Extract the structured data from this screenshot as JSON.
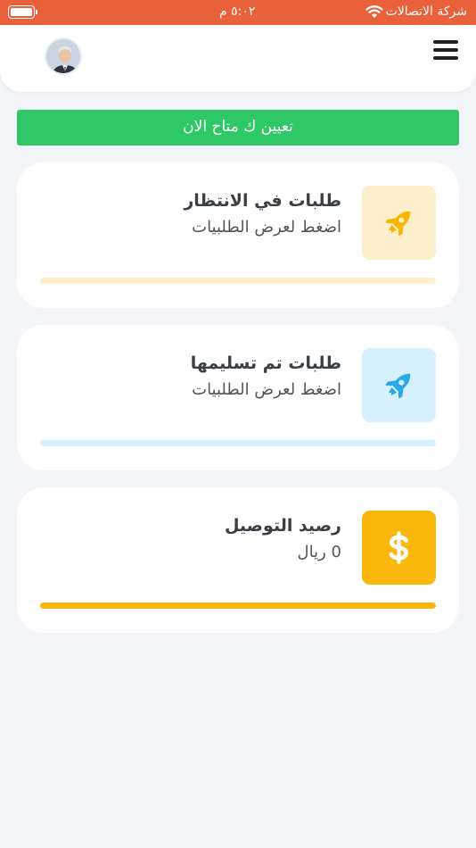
{
  "status_bar": {
    "carrier": "شركة الاتصالات",
    "time": "٥:٠٢ م",
    "icons": [
      "wifi-icon",
      "battery-icon"
    ]
  },
  "header": {
    "menu_icon": "hamburger-menu-icon",
    "avatar": "user-avatar"
  },
  "availability_button": {
    "label": "تعيين ك متاح الان"
  },
  "cards": [
    {
      "title": "طلبات في الانتظار",
      "subtitle": "اضغط لعرض الطلبيات",
      "icon": "rocket-icon",
      "icon_color": "#f7b600",
      "icon_bg": "#fdefcb",
      "bar_color": "#fdefcb"
    },
    {
      "title": "طلبات تم تسليمها",
      "subtitle": "اضغط لعرض الطلبيات",
      "icon": "rocket-icon",
      "icon_color": "#2aa8e8",
      "icon_bg": "#d6f1fd",
      "bar_color": "#d6f1fd"
    },
    {
      "title": "رصيد التوصيل",
      "subtitle": "0 ريال",
      "icon": "dollar-icon",
      "icon_color": "#ffffff",
      "icon_bg": "#fbb80c",
      "bar_color": "#fbb80c"
    }
  ],
  "colors": {
    "status_bar": "#e9613a",
    "available_green": "#2ec866",
    "background": "#f4f5f9"
  }
}
